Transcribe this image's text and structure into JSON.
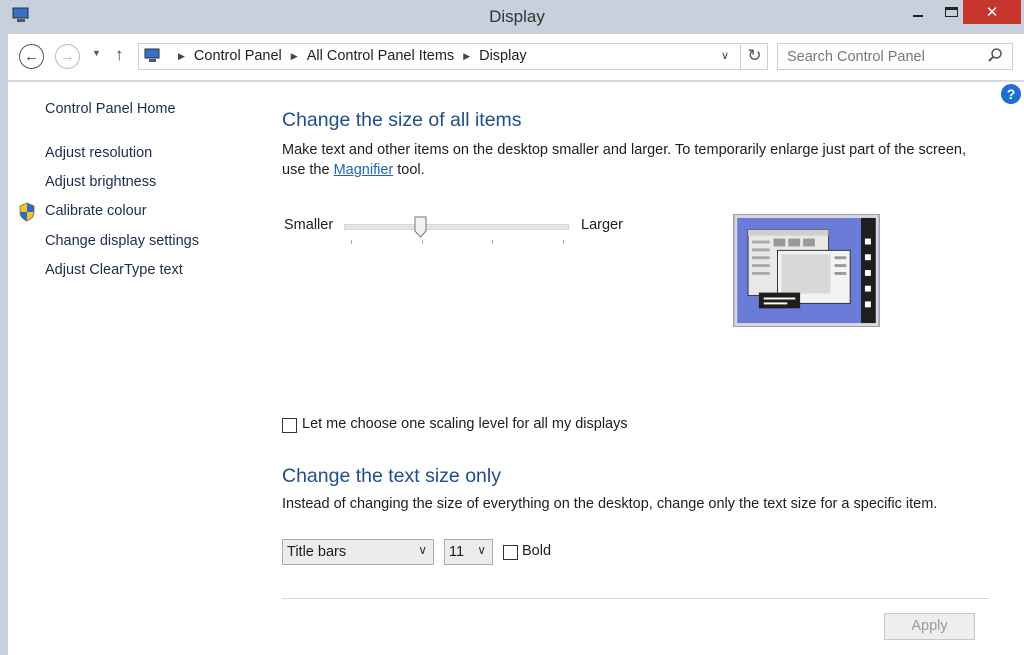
{
  "window": {
    "title": "Display"
  },
  "nav": {
    "breadcrumbs": [
      "Control Panel",
      "All Control Panel Items",
      "Display"
    ],
    "search_placeholder": "Search Control Panel"
  },
  "sidebar": {
    "home": "Control Panel Home",
    "links": [
      "Adjust resolution",
      "Adjust brightness",
      "Calibrate colour",
      "Change display settings",
      "Adjust ClearType text"
    ]
  },
  "main": {
    "section1_title": "Change the size of all items",
    "section1_text_before": "Make text and other items on the desktop smaller and larger. To temporarily enlarge just part of the screen, use the ",
    "section1_link": "Magnifier",
    "section1_text_after": " tool.",
    "slider_min_label": "Smaller",
    "slider_max_label": "Larger",
    "slider_value_fraction": 0.33,
    "scaling_checkbox_label": "Let me choose one scaling level for all my displays",
    "section2_title": "Change the text size only",
    "section2_text": "Instead of changing the size of everything on the desktop, change only the text size for a specific item.",
    "item_select_value": "Title bars",
    "size_select_value": "11",
    "bold_label": "Bold",
    "apply_label": "Apply"
  },
  "colors": {
    "accent_heading": "#1f4e8c",
    "close_button": "#c7352c",
    "link": "#1f64b8"
  }
}
